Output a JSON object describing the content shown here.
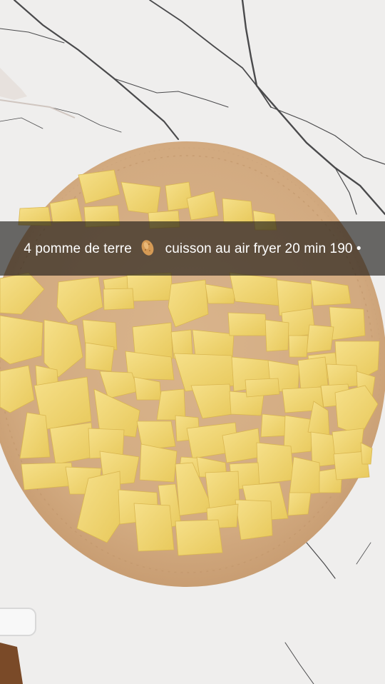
{
  "caption": {
    "text_before_icon": "4 pomme de terre",
    "icon": "potato-emoji",
    "text_after_icon": "cuisson au air fryer 20 min 190 •"
  },
  "colors": {
    "countertop": "#efeeed",
    "marble_vein": "#4a4a4c",
    "parchment": "#d3ad84",
    "potato": "#f1d778",
    "caption_bg": "rgba(20,18,16,0.62)"
  }
}
